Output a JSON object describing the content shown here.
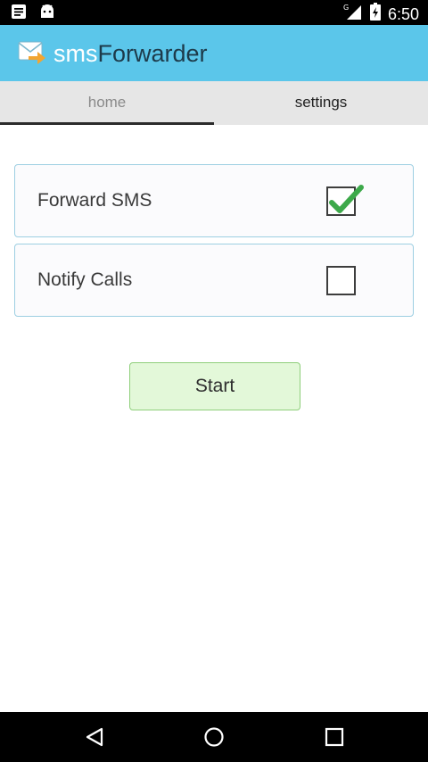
{
  "status_bar": {
    "time": "6:50",
    "icons": [
      "notes-icon",
      "android-icon",
      "signal-icon",
      "battery-icon"
    ],
    "network_label": "G"
  },
  "app_bar": {
    "title_part1": "sms",
    "title_part2": "Forwarder",
    "icon": "envelope-forward-icon",
    "color": "#5bc6ea"
  },
  "tabs": [
    {
      "label": "home",
      "selected": true
    },
    {
      "label": "settings",
      "selected": false
    }
  ],
  "options": [
    {
      "label": "Forward SMS",
      "checked": true
    },
    {
      "label": "Notify Calls",
      "checked": false
    }
  ],
  "start_button": {
    "label": "Start"
  },
  "nav_bar": {
    "icons": [
      "back-icon",
      "home-icon",
      "recents-icon"
    ]
  }
}
